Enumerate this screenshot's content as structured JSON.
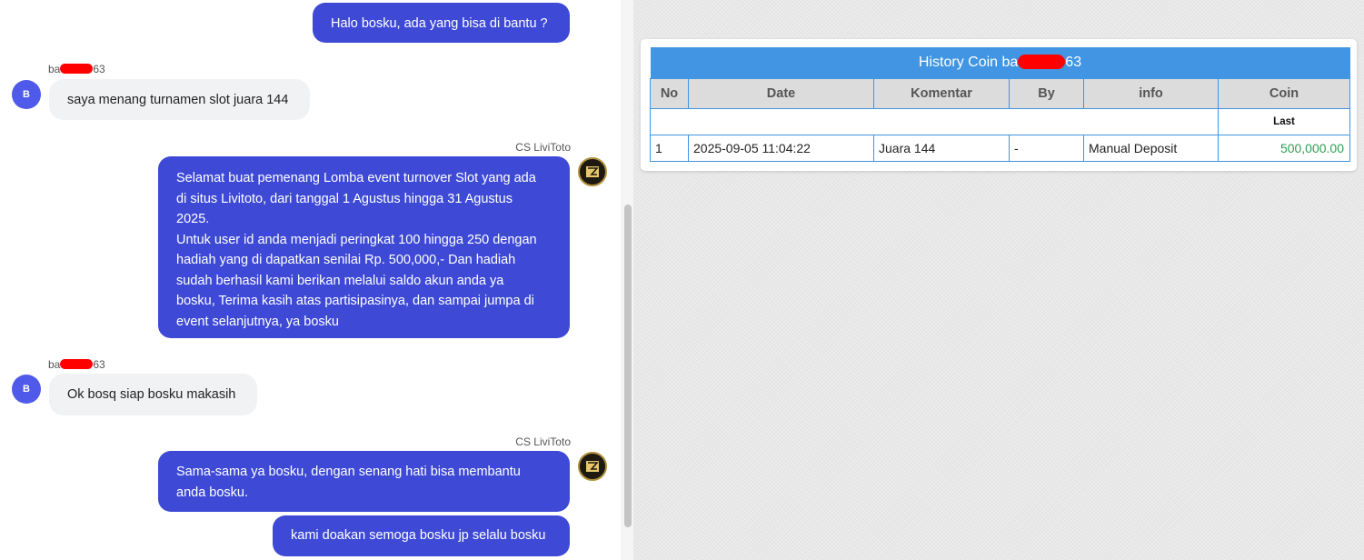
{
  "chat": {
    "messages": [
      {
        "type": "outgoing",
        "text": "Halo bosku, ada yang bisa di bantu ?"
      },
      {
        "type": "incoming",
        "sender_prefix": "ba",
        "sender_suffix": "63",
        "avatar": "B",
        "text": "saya menang turnamen slot juara 144"
      },
      {
        "type": "outgoing",
        "sender": "CS LiviToto",
        "lines": [
          "Selamat buat pemenang Lomba event turnover Slot yang ada",
          "di situs Livitoto, dari tanggal 1 Agustus hingga 31 Agustus",
          "2025.",
          "Untuk user id anda menjadi peringkat 100 hingga 250 dengan",
          "hadiah yang di dapatkan senilai Rp. 500,000,- Dan hadiah",
          "sudah berhasil kami berikan melalui saldo akun anda ya",
          "bosku, Terima kasih atas partisipasinya, dan sampai jumpa di",
          "event selanjutnya, ya bosku"
        ]
      },
      {
        "type": "incoming",
        "sender_prefix": "ba",
        "sender_suffix": "63",
        "avatar": "B",
        "text": "Ok bosq siap bosku makasih"
      },
      {
        "type": "outgoing",
        "sender": "CS LiviToto",
        "lines": [
          "Sama-sama ya bosku, dengan senang hati bisa membantu",
          "anda bosku."
        ]
      },
      {
        "type": "outgoing",
        "text": "kami doakan semoga bosku jp selalu bosku"
      }
    ]
  },
  "history": {
    "title_prefix": "History Coin ba",
    "title_suffix": "63",
    "columns": [
      "No",
      "Date",
      "Komentar",
      "By",
      "info",
      "Coin"
    ],
    "subheader": "Last",
    "rows": [
      {
        "no": "1",
        "date": "2025-09-05 11:04:22",
        "komentar": "Juara 144",
        "by": "-",
        "info": "Manual Deposit",
        "coin": "500,000.00"
      }
    ]
  },
  "colors": {
    "outgoing_bubble": "#3e4ad6",
    "incoming_bubble": "#f1f2f4",
    "table_header": "#4195e2",
    "coin_value": "#2f9e55",
    "redaction": "#ff0000"
  }
}
